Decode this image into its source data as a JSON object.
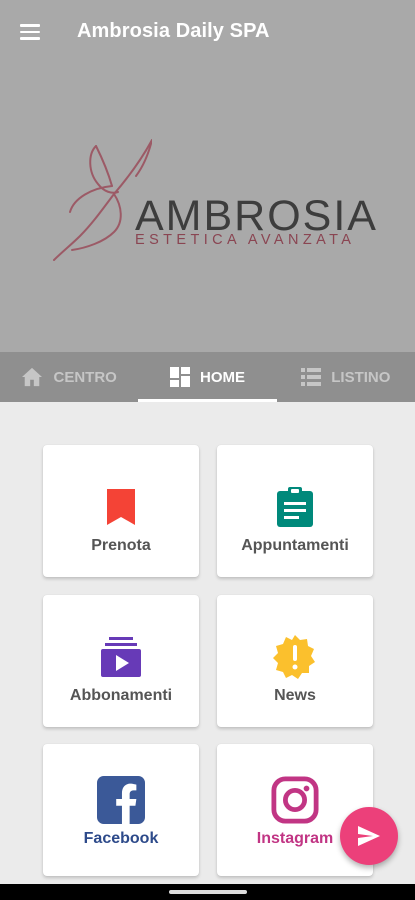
{
  "app": {
    "title": "Ambrosia Daily SPA"
  },
  "logo": {
    "word": "AMBROSIA",
    "subtitle": "ESTETICA AVANZATA"
  },
  "tabs": [
    {
      "label": "CENTRO",
      "icon": "home-icon",
      "active": false
    },
    {
      "label": "HOME",
      "icon": "dashboard-icon",
      "active": true
    },
    {
      "label": "LISTINO",
      "icon": "list-icon",
      "active": false
    }
  ],
  "cards": [
    {
      "label": "Prenota",
      "icon": "bookmark-icon",
      "color": "#f44336"
    },
    {
      "label": "Appuntamenti",
      "icon": "clipboard-icon",
      "color": "#00897b"
    },
    {
      "label": "Abbonamenti",
      "icon": "subscriptions-icon",
      "color": "#673ab7"
    },
    {
      "label": "News",
      "icon": "news-badge-icon",
      "color": "#fbc02d"
    },
    {
      "label": "Facebook",
      "icon": "facebook-icon",
      "color": "#3b5998"
    },
    {
      "label": "Instagram",
      "icon": "instagram-icon",
      "color": "#c13584"
    }
  ],
  "colors": {
    "header": "#a9a9a9",
    "tabbar": "#8f8f8f",
    "fab": "#ec407a",
    "background": "#ebebeb"
  },
  "fab": {
    "icon": "send-icon"
  }
}
